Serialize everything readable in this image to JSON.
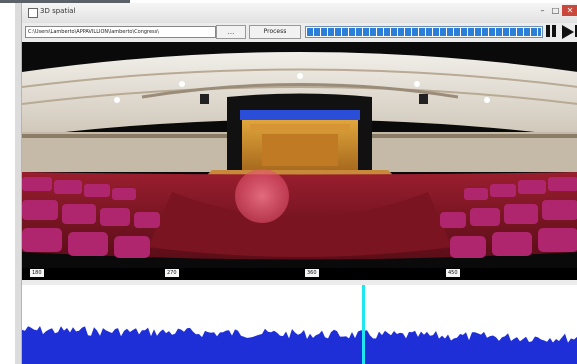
{
  "window": {
    "title": "3D spatial",
    "buttons": {
      "minimize": "–",
      "maximize": "□",
      "close": "✕"
    }
  },
  "toolbar": {
    "path_value": "C:\\Users\\Lamberto\\APPAVILLION\\lamberto\\Congress\\",
    "browse_label": "...",
    "process_label": "Process",
    "progress_fraction": 1.0
  },
  "controls": {
    "pause_icon": "pause-icon",
    "play_icon": "play-icon",
    "stop_icon": "stop-icon"
  },
  "ruler": {
    "ticks": [
      "180",
      "270",
      "360",
      "450"
    ]
  },
  "analysis": {
    "highlight_color": "#e0506a",
    "spectrum_color": "#1f2fd8",
    "marker_color": "#20e6f0"
  }
}
